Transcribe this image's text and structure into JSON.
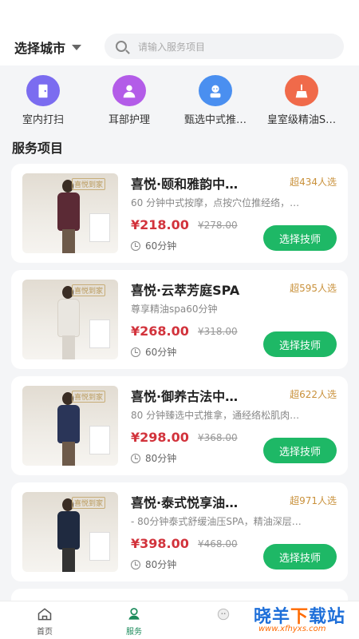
{
  "header": {
    "city_label": "选择城市",
    "search_placeholder": "请输入服务项目"
  },
  "categories": [
    {
      "label": "室内打扫",
      "icon": "door-icon",
      "color": "#7b6cf0"
    },
    {
      "label": "耳部护理",
      "icon": "person-icon",
      "color": "#b35ce8"
    },
    {
      "label": "甄选中式推…",
      "icon": "therapist-icon",
      "color": "#4a8ff0"
    },
    {
      "label": "皇室级精油S…",
      "icon": "broom-icon",
      "color": "#f06a4a"
    }
  ],
  "section_title": "服务项目",
  "services": [
    {
      "name": "喜悦·颐和雅韵中…",
      "sold": "超434人选",
      "desc": "60 分钟中式按摩，点按穴位推经络，…",
      "price": "¥218.00",
      "original_price": "¥278.00",
      "duration": "60分钟",
      "button": "选择技师",
      "dress_color": "#5b2a35",
      "watermark": "喜悦到家"
    },
    {
      "name": "喜悦·云萃芳庭SPA",
      "sold": "超595人选",
      "desc": "尊享精油spa60分钟",
      "price": "¥268.00",
      "original_price": "¥318.00",
      "duration": "60分钟",
      "button": "选择技师",
      "dress_color": "#e9e6e0",
      "watermark": "喜悦到家"
    },
    {
      "name": "喜悦·御养古法中…",
      "sold": "超622人选",
      "desc": "80 分钟臻选中式推拿，通经络松肌肉…",
      "price": "¥298.00",
      "original_price": "¥368.00",
      "duration": "80分钟",
      "button": "选择技师",
      "dress_color": "#2a3558",
      "watermark": "喜悦到家"
    },
    {
      "name": "喜悦·泰式悦享油…",
      "sold": "超971人选",
      "desc": "- 80分钟泰式舒缓油压SPA，精油深层…",
      "price": "¥398.00",
      "original_price": "¥468.00",
      "duration": "80分钟",
      "button": "选择技师",
      "dress_color": "#1f2a40",
      "watermark": "喜悦到家"
    }
  ],
  "tabbar": [
    {
      "label": "首页",
      "icon": "home-icon"
    },
    {
      "label": "服务",
      "icon": "service-icon"
    },
    {
      "label": "",
      "icon": "sheep-icon"
    }
  ],
  "watermark": {
    "title_a": "晓羊",
    "title_b": "下",
    "title_c": "载站",
    "url": "www.xfhyxs.com"
  }
}
